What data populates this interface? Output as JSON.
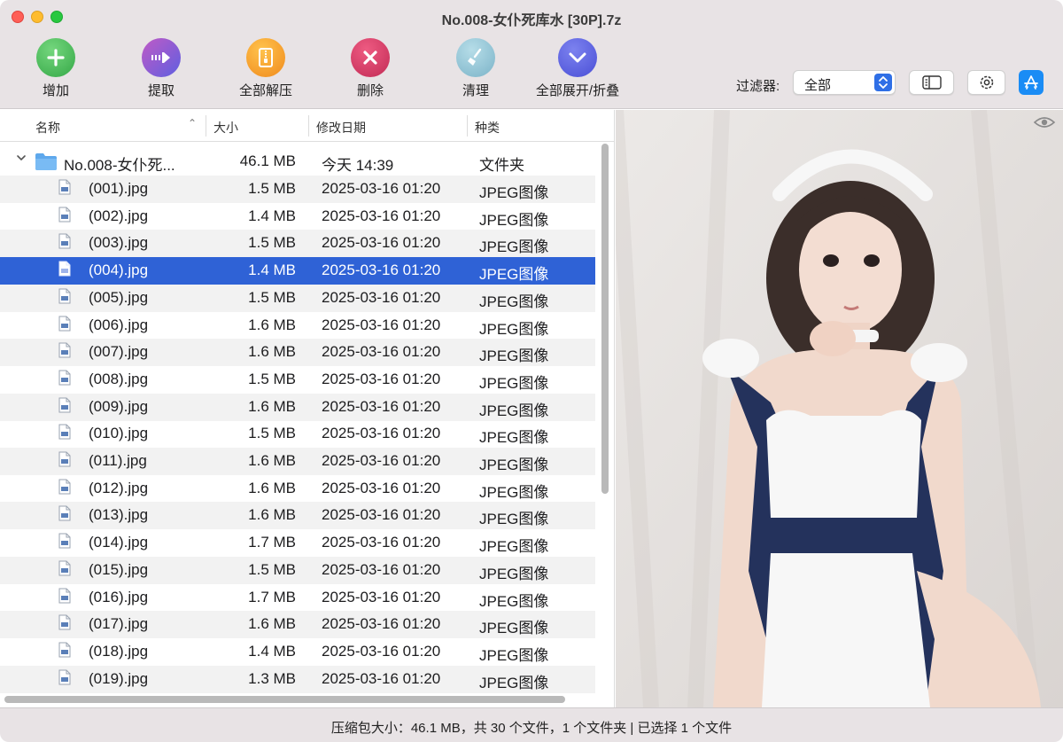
{
  "window": {
    "title": "No.008-女仆死库水 [30P].7z"
  },
  "toolbar": {
    "add": "增加",
    "extract": "提取",
    "extract_all": "全部解压",
    "delete": "删除",
    "clean": "清理",
    "expand_collapse": "全部展开/折叠",
    "filter_label": "过滤器:",
    "filter_value": "全部"
  },
  "columns": {
    "name": "名称",
    "size": "大小",
    "date": "修改日期",
    "kind": "种类"
  },
  "folder": {
    "name": "No.008-女仆死...",
    "size": "46.1 MB",
    "date": "今天 14:39",
    "kind": "文件夹"
  },
  "files": [
    {
      "name": "(001).jpg",
      "size": "1.5 MB",
      "date": "2025-03-16 01:20",
      "kind": "JPEG图像"
    },
    {
      "name": "(002).jpg",
      "size": "1.4 MB",
      "date": "2025-03-16 01:20",
      "kind": "JPEG图像"
    },
    {
      "name": "(003).jpg",
      "size": "1.5 MB",
      "date": "2025-03-16 01:20",
      "kind": "JPEG图像"
    },
    {
      "name": "(004).jpg",
      "size": "1.4 MB",
      "date": "2025-03-16 01:20",
      "kind": "JPEG图像",
      "selected": true
    },
    {
      "name": "(005).jpg",
      "size": "1.5 MB",
      "date": "2025-03-16 01:20",
      "kind": "JPEG图像"
    },
    {
      "name": "(006).jpg",
      "size": "1.6 MB",
      "date": "2025-03-16 01:20",
      "kind": "JPEG图像"
    },
    {
      "name": "(007).jpg",
      "size": "1.6 MB",
      "date": "2025-03-16 01:20",
      "kind": "JPEG图像"
    },
    {
      "name": "(008).jpg",
      "size": "1.5 MB",
      "date": "2025-03-16 01:20",
      "kind": "JPEG图像"
    },
    {
      "name": "(009).jpg",
      "size": "1.6 MB",
      "date": "2025-03-16 01:20",
      "kind": "JPEG图像"
    },
    {
      "name": "(010).jpg",
      "size": "1.5 MB",
      "date": "2025-03-16 01:20",
      "kind": "JPEG图像"
    },
    {
      "name": "(011).jpg",
      "size": "1.6 MB",
      "date": "2025-03-16 01:20",
      "kind": "JPEG图像"
    },
    {
      "name": "(012).jpg",
      "size": "1.6 MB",
      "date": "2025-03-16 01:20",
      "kind": "JPEG图像"
    },
    {
      "name": "(013).jpg",
      "size": "1.6 MB",
      "date": "2025-03-16 01:20",
      "kind": "JPEG图像"
    },
    {
      "name": "(014).jpg",
      "size": "1.7 MB",
      "date": "2025-03-16 01:20",
      "kind": "JPEG图像"
    },
    {
      "name": "(015).jpg",
      "size": "1.5 MB",
      "date": "2025-03-16 01:20",
      "kind": "JPEG图像"
    },
    {
      "name": "(016).jpg",
      "size": "1.7 MB",
      "date": "2025-03-16 01:20",
      "kind": "JPEG图像"
    },
    {
      "name": "(017).jpg",
      "size": "1.6 MB",
      "date": "2025-03-16 01:20",
      "kind": "JPEG图像"
    },
    {
      "name": "(018).jpg",
      "size": "1.4 MB",
      "date": "2025-03-16 01:20",
      "kind": "JPEG图像"
    },
    {
      "name": "(019).jpg",
      "size": "1.3 MB",
      "date": "2025-03-16 01:20",
      "kind": "JPEG图像"
    }
  ],
  "status": {
    "text": "压缩包大小：46.1 MB，共 30 个文件，1 个文件夹 | 已选择 1 个文件"
  },
  "icons": {
    "add": "plus-icon",
    "extract": "extract-arrow-icon",
    "extract_all": "zip-archive-icon",
    "delete": "delete-x-icon",
    "clean": "broom-icon",
    "expand": "chevron-down-icon",
    "sidebar": "sidebar-toggle-icon",
    "settings": "gear-icon",
    "appstore": "app-store-icon",
    "preview": "eye-icon",
    "folder": "folder-icon",
    "file": "jpeg-file-icon"
  },
  "colors": {
    "selection": "#2f62d6",
    "add": "#4cc25a",
    "extract": "#8e5ad6",
    "extract_all": "#f4a12a",
    "delete": "#d93a66",
    "clean": "#8fc3d4",
    "expand": "#5b5fe0"
  }
}
